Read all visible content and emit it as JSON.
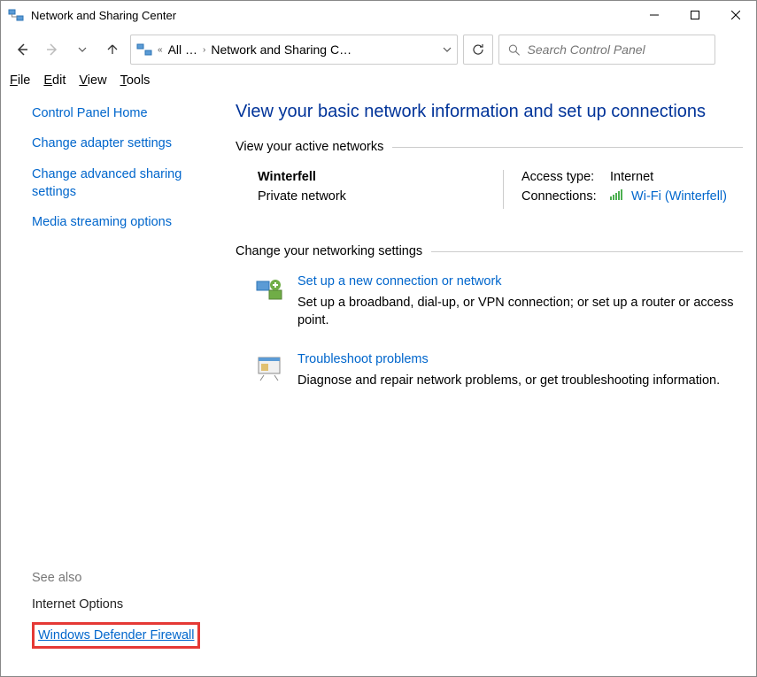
{
  "window": {
    "title": "Network and Sharing Center"
  },
  "breadcrumb": {
    "prefix": "«",
    "seg1": "All …",
    "seg2": "Network and Sharing C…"
  },
  "search": {
    "placeholder": "Search Control Panel"
  },
  "menubar": {
    "file": "File",
    "edit": "Edit",
    "view": "View",
    "tools": "Tools"
  },
  "sidebar": {
    "home": "Control Panel Home",
    "adapter": "Change adapter settings",
    "advanced": "Change advanced sharing settings",
    "media": "Media streaming options",
    "seealso_header": "See also",
    "internet_options": "Internet Options",
    "firewall": "Windows Defender Firewall"
  },
  "main": {
    "heading": "View your basic network information and set up connections",
    "active_header": "View your active networks",
    "network": {
      "name": "Winterfell",
      "type": "Private network",
      "access_label": "Access type:",
      "access_value": "Internet",
      "conn_label": "Connections:",
      "conn_value": "Wi-Fi (Winterfell)"
    },
    "change_header": "Change your networking settings",
    "items": [
      {
        "title": "Set up a new connection or network",
        "desc": "Set up a broadband, dial-up, or VPN connection; or set up a router or access point."
      },
      {
        "title": "Troubleshoot problems",
        "desc": "Diagnose and repair network problems, or get troubleshooting information."
      }
    ]
  }
}
